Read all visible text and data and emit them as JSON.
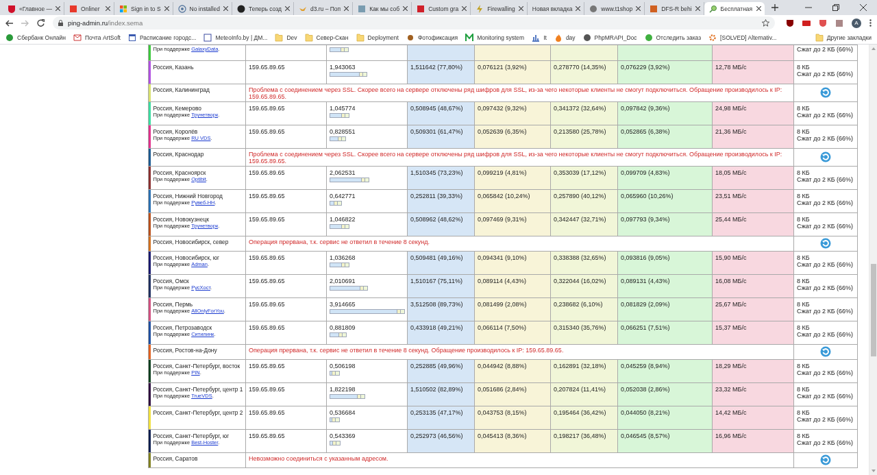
{
  "browser": {
    "tabs": [
      {
        "title": "«Главное —",
        "selected": false
      },
      {
        "title": "Onliner",
        "selected": false
      },
      {
        "title": "Sign in to S",
        "selected": false
      },
      {
        "title": "No installed",
        "selected": false
      },
      {
        "title": "Теперь созд",
        "selected": false
      },
      {
        "title": "d3.ru – Поп",
        "selected": false
      },
      {
        "title": "Как мы соб",
        "selected": false
      },
      {
        "title": "Custom gra",
        "selected": false
      },
      {
        "title": "Firewalling",
        "selected": false
      },
      {
        "title": "Новая вкладка",
        "selected": false
      },
      {
        "title": "www.t1shop",
        "selected": false
      },
      {
        "title": "DFS-R behi",
        "selected": false
      },
      {
        "title": "Бесплатная",
        "selected": true
      }
    ],
    "address": {
      "host": "ping-admin.ru",
      "path": "/index.sema"
    },
    "profile_initial": "A",
    "bookmarks": [
      {
        "label": "Сбербанк Онлайн",
        "kind": "site"
      },
      {
        "label": "Почта ArtSoft",
        "kind": "site"
      },
      {
        "label": "Расписание городс...",
        "kind": "site"
      },
      {
        "label": "MeteoInfo.by | ДМ...",
        "kind": "site"
      },
      {
        "label": "Dev",
        "kind": "folder"
      },
      {
        "label": "Север-Скан",
        "kind": "folder"
      },
      {
        "label": "Deployment",
        "kind": "folder"
      },
      {
        "label": "Фотофиксация",
        "kind": "site"
      },
      {
        "label": "Monitoring system",
        "kind": "site"
      },
      {
        "label": "It",
        "kind": "site"
      },
      {
        "label": "day",
        "kind": "site"
      },
      {
        "label": "PhpMRAPI_Doc",
        "kind": "site"
      },
      {
        "label": "Отследить заказ",
        "kind": "site"
      },
      {
        "label": "[SOLVED] Alternativ...",
        "kind": "site"
      }
    ],
    "other_bookmarks": "Другие закладки"
  },
  "table": {
    "rows": [
      {
        "kind": "partial",
        "color": "#3cc83c",
        "sponsor": {
          "prefix": "При поддержке",
          "link": "GalaxyData",
          "suffix": "."
        },
        "level": 0.25,
        "compressed": "Сжат до 2 КБ (66%)"
      },
      {
        "kind": "result",
        "color": "#b050e0",
        "location": "Россия, Казань",
        "ip": "159.65.89.65",
        "total": "1,943063",
        "level": 0.49,
        "timings": [
          "1,511642 (77,80%)",
          "0,076121 (3,92%)",
          "0,278770 (14,35%)",
          "0,076229 (3,92%)"
        ],
        "speed": "12,78 МБ/с",
        "size": "8 КБ",
        "compressed": "Сжат до 2 КБ (66%)"
      },
      {
        "kind": "error",
        "color": "#d8e070",
        "location": "Россия, Калининград",
        "message": "Проблема с соединением через SSL. Скорее всего на сервере отключены ряд шифров для SSL, из-за чего некоторые клиенты не смогут подключиться. Обращение производилось к IP: 159.65.89.65."
      },
      {
        "kind": "result",
        "color": "#3cdca0",
        "location": "Россия, Кемерово",
        "sponsor": {
          "prefix": "При поддержке",
          "link": "Трунетворк",
          "suffix": "."
        },
        "ip": "159.65.89.65",
        "total": "1,045774",
        "level": 0.26,
        "timings": [
          "0,508945 (48,67%)",
          "0,097432 (9,32%)",
          "0,341372 (32,64%)",
          "0,097842 (9,36%)"
        ],
        "speed": "24,98 МБ/с",
        "size": "8 КБ",
        "compressed": "Сжат до 2 КБ (66%)"
      },
      {
        "kind": "result",
        "color": "#e0308a",
        "location": "Россия, Королёв",
        "sponsor": {
          "prefix": "При поддержке",
          "link": "RU VDS",
          "suffix": "."
        },
        "ip": "159.65.89.65",
        "total": "0,828551",
        "level": 0.21,
        "timings": [
          "0,509301 (61,47%)",
          "0,052639 (6,35%)",
          "0,213580 (25,78%)",
          "0,052865 (6,38%)"
        ],
        "speed": "21,36 МБ/с",
        "size": "8 КБ",
        "compressed": "Сжат до 2 КБ (66%)"
      },
      {
        "kind": "error",
        "color": "#1c5a90",
        "location": "Россия, Краснодар",
        "message": "Проблема с соединением через SSL. Скорее всего на сервере отключены ряд шифров для SSL, из-за чего некоторые клиенты не смогут подключиться. Обращение производилось к IP: 159.65.89.65."
      },
      {
        "kind": "result",
        "color": "#8a3030",
        "location": "Россия, Красноярск",
        "sponsor": {
          "prefix": "При поддержке",
          "link": "Optibit",
          "suffix": "."
        },
        "ip": "159.65.89.65",
        "total": "2,062531",
        "level": 0.52,
        "timings": [
          "1,510345 (73,23%)",
          "0,099219 (4,81%)",
          "0,353039 (17,12%)",
          "0,099709 (4,83%)"
        ],
        "speed": "18,05 МБ/с",
        "size": "8 КБ",
        "compressed": "Сжат до 2 КБ (66%)"
      },
      {
        "kind": "result",
        "color": "#2a6fb0",
        "location": "Россия, Нижний Новгород",
        "sponsor": {
          "prefix": "При поддержке",
          "link": "Рувеб-НН",
          "suffix": "."
        },
        "ip": "159.65.89.65",
        "total": "0,642771",
        "level": 0.16,
        "timings": [
          "0,252811 (39,33%)",
          "0,065842 (10,24%)",
          "0,257890 (40,12%)",
          "0,065960 (10,26%)"
        ],
        "speed": "23,51 МБ/с",
        "size": "8 КБ",
        "compressed": "Сжат до 2 КБ (66%)"
      },
      {
        "kind": "result",
        "color": "#b8501c",
        "location": "Россия, Новокузнецк",
        "sponsor": {
          "prefix": "При поддержке",
          "link": "Трунетворк",
          "suffix": "."
        },
        "ip": "159.65.89.65",
        "total": "1,046822",
        "level": 0.26,
        "timings": [
          "0,508962 (48,62%)",
          "0,097469 (9,31%)",
          "0,342447 (32,71%)",
          "0,097793 (9,34%)"
        ],
        "speed": "25,44 МБ/с",
        "size": "8 КБ",
        "compressed": "Сжат до 2 КБ (66%)"
      },
      {
        "kind": "error",
        "color": "#d07020",
        "location": "Россия, Новосибирск, север",
        "message": "Операция прервана, т.к. сервис не ответил в течение 8 секунд."
      },
      {
        "kind": "result",
        "color": "#1a1a70",
        "location": "Россия, Новосибирск, юг",
        "sponsor": {
          "prefix": "При поддержке",
          "link": "Adman",
          "suffix": "."
        },
        "ip": "159.65.89.65",
        "total": "1,036268",
        "level": 0.26,
        "timings": [
          "0,509481 (49,16%)",
          "0,094341 (9,10%)",
          "0,338388 (32,65%)",
          "0,093816 (9,05%)"
        ],
        "speed": "15,90 МБ/с",
        "size": "8 КБ",
        "compressed": "Сжат до 2 КБ (66%)"
      },
      {
        "kind": "result",
        "color": "#203060",
        "location": "Россия, Омск",
        "sponsor": {
          "prefix": "При поддержке",
          "link": "РусХост",
          "suffix": "."
        },
        "ip": "159.65.89.65",
        "total": "2,010691",
        "level": 0.5,
        "timings": [
          "1,510167 (75,11%)",
          "0,089114 (4,43%)",
          "0,322044 (16,02%)",
          "0,089131 (4,43%)"
        ],
        "speed": "16,08 МБ/с",
        "size": "8 КБ",
        "compressed": "Сжат до 2 КБ (66%)"
      },
      {
        "kind": "result",
        "color": "#d05080",
        "location": "Россия, Пермь",
        "sponsor": {
          "prefix": "При поддержке",
          "link": "AllOnlyForYou",
          "suffix": "."
        },
        "ip": "159.65.89.65",
        "total": "3,914665",
        "level": 0.98,
        "timings": [
          "3,512508 (89,73%)",
          "0,081499 (2,08%)",
          "0,238682 (6,10%)",
          "0,081829 (2,09%)"
        ],
        "speed": "25,67 МБ/с",
        "size": "8 КБ",
        "compressed": "Сжат до 2 КБ (66%)"
      },
      {
        "kind": "result",
        "color": "#2050a0",
        "location": "Россия, Петрозаводск",
        "sponsor": {
          "prefix": "При поддержке",
          "link": "Ситилинк",
          "suffix": "."
        },
        "ip": "159.65.89.65",
        "total": "0,881809",
        "level": 0.22,
        "timings": [
          "0,433918 (49,21%)",
          "0,066114 (7,50%)",
          "0,315340 (35,76%)",
          "0,066251 (7,51%)"
        ],
        "speed": "15,37 МБ/с",
        "size": "8 КБ",
        "compressed": "Сжат до 2 КБ (66%)"
      },
      {
        "kind": "error",
        "color": "#e06020",
        "location": "Россия, Ростов-на-Дону",
        "message": "Операция прервана, т.к. сервис не ответил в течение 8 секунд. Обращение производилось к IP: 159.65.89.65."
      },
      {
        "kind": "result",
        "color": "#104020",
        "location": "Россия, Санкт-Петербург, восток",
        "sponsor": {
          "prefix": "При поддержке",
          "link": "PIN",
          "suffix": "."
        },
        "ip": "159.65.89.65",
        "total": "0,506198",
        "level": 0.13,
        "timings": [
          "0,252885 (49,96%)",
          "0,044942 (8,88%)",
          "0,162891 (32,18%)",
          "0,045259 (8,94%)"
        ],
        "speed": "18,29 МБ/с",
        "size": "8 КБ",
        "compressed": "Сжат до 2 КБ (66%)"
      },
      {
        "kind": "result",
        "color": "#301040",
        "location": "Россия, Санкт-Петербург, центр 1",
        "sponsor": {
          "prefix": "При поддержке",
          "link": "TrueVDS",
          "suffix": "."
        },
        "ip": "159.65.89.65",
        "total": "1,822198",
        "level": 0.46,
        "timings": [
          "1,510502 (82,89%)",
          "0,051686 (2,84%)",
          "0,207824 (11,41%)",
          "0,052038 (2,86%)"
        ],
        "speed": "23,32 МБ/с",
        "size": "8 КБ",
        "compressed": "Сжат до 2 КБ (66%)"
      },
      {
        "kind": "result",
        "color": "#f0e040",
        "location": "Россия, Санкт-Петербург, центр 2",
        "ip": "159.65.89.65",
        "total": "0,536684",
        "level": 0.13,
        "timings": [
          "0,253135 (47,17%)",
          "0,043753 (8,15%)",
          "0,195464 (36,42%)",
          "0,044050 (8,21%)"
        ],
        "speed": "14,42 МБ/с",
        "size": "8 КБ",
        "compressed": "Сжат до 2 КБ (66%)"
      },
      {
        "kind": "result",
        "color": "#102050",
        "location": "Россия, Санкт-Петербург, юг",
        "sponsor": {
          "prefix": "При поддержке",
          "link": "Best-Hoster",
          "suffix": "."
        },
        "ip": "159.65.89.65",
        "total": "0,543369",
        "level": 0.14,
        "timings": [
          "0,252973 (46,56%)",
          "0,045413 (8,36%)",
          "0,198217 (36,48%)",
          "0,046545 (8,57%)"
        ],
        "speed": "16,96 МБ/с",
        "size": "8 КБ",
        "compressed": "Сжат до 2 КБ (66%)"
      },
      {
        "kind": "error",
        "color": "#808020",
        "location": "Россия, Саратов",
        "message": "Невозможно соединиться с указанным адресом."
      }
    ]
  }
}
